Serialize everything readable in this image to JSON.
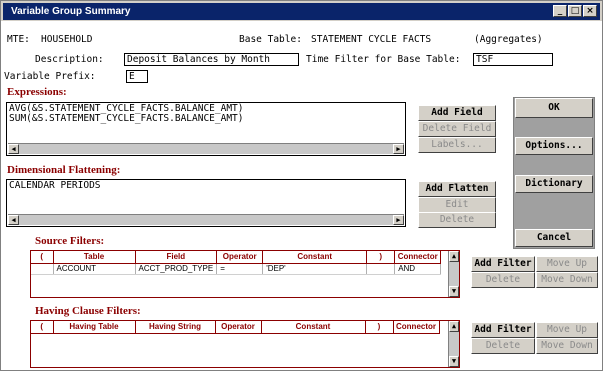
{
  "window": {
    "title": "Variable Group Summary",
    "controls": [
      "_",
      "□",
      "×"
    ]
  },
  "header": {
    "mte_label": "MTE:",
    "mte_value": "HOUSEHOLD",
    "base_table_label": "Base Table:",
    "base_table_value": "STATEMENT CYCLE FACTS",
    "aggregates": "(Aggregates)"
  },
  "description": {
    "label": "Description:",
    "value": "Deposit Balances by Month"
  },
  "time_filter": {
    "label": "Time Filter for Base Table:",
    "value": "TSF"
  },
  "variable_prefix": {
    "label": "Variable Prefix:",
    "value": "E"
  },
  "expressions": {
    "title": "Expressions:",
    "lines": [
      "AVG(&S.STATEMENT_CYCLE_FACTS.BALANCE_AMT)",
      "SUM(&S.STATEMENT_CYCLE_FACTS.BALANCE_AMT)"
    ],
    "buttons": {
      "add": "Add Field",
      "delete": "Delete Field",
      "labels": "Labels..."
    }
  },
  "flattening": {
    "title": "Dimensional Flattening:",
    "lines": [
      "CALENDAR PERIODS"
    ],
    "buttons": {
      "add": "Add Flatten",
      "edit": "Edit",
      "delete": "Delete"
    }
  },
  "right_buttons": {
    "ok": "OK",
    "options": "Options...",
    "dictionary": "Dictionary",
    "cancel": "Cancel"
  },
  "source_filters": {
    "title": "Source Filters:",
    "columns": [
      "(",
      "Table",
      "Field",
      "Operator",
      "Constant",
      ")",
      "Connector"
    ],
    "rows": [
      {
        "open": "",
        "table": "ACCOUNT",
        "field": "ACCT_PROD_TYPE",
        "operator": "=",
        "constant": "'DEP'",
        "close": "",
        "connector": "AND"
      }
    ],
    "buttons": {
      "add": "Add Filter",
      "move_up": "Move Up",
      "delete": "Delete",
      "move_down": "Move Down"
    }
  },
  "having_filters": {
    "title": "Having Clause Filters:",
    "columns": [
      "(",
      "Having Table",
      "Having String",
      "Operator",
      "Constant",
      ")",
      "Connector"
    ],
    "buttons": {
      "add": "Add Filter",
      "move_up": "Move Up",
      "delete": "Delete",
      "move_down": "Move Down"
    }
  }
}
